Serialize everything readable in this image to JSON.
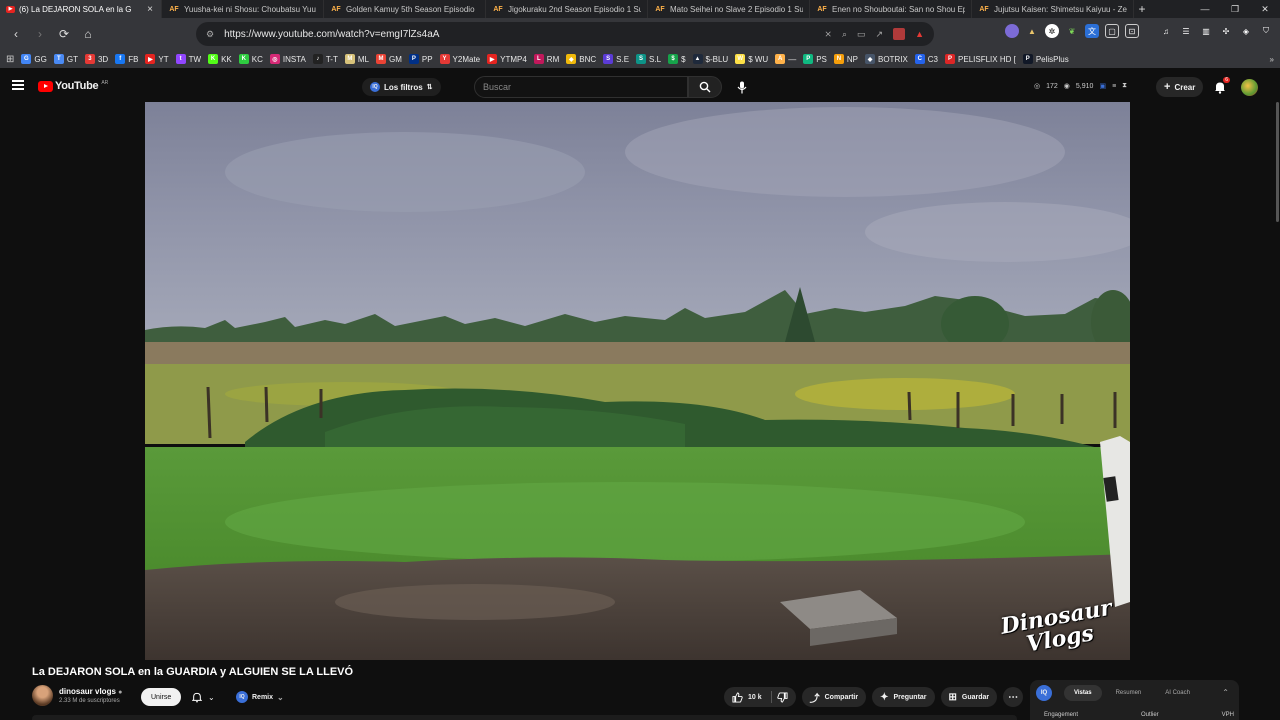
{
  "browser": {
    "tabs": [
      {
        "label": "(6) La DEJARON SOLA en la G",
        "icon": "youtube-icon",
        "active": true
      },
      {
        "label": "Yuusha-kei ni Shosu: Choubatsu Yuu",
        "icon": "af-icon"
      },
      {
        "label": "Golden Kamuy 5th Season Episodio",
        "icon": "af-icon"
      },
      {
        "label": "Jigokuraku 2nd Season Episodio 1 Su",
        "icon": "af-icon"
      },
      {
        "label": "Mato Seihei no Slave 2 Episodio 1 Su",
        "icon": "af-icon"
      },
      {
        "label": "Enen no Shouboutai: San no Shou Ep",
        "icon": "af-icon"
      },
      {
        "label": "Jujutsu Kaisen: Shimetsu Kaiyuu - Ze",
        "icon": "af-icon"
      }
    ],
    "af_label": "AF",
    "url": "https://www.youtube.com/watch?v=emgI7lZs4aA",
    "bookmarks": [
      {
        "label": "GG",
        "color": "#4285f4",
        "glyph": "G"
      },
      {
        "label": "GT",
        "color": "#4a8af4",
        "glyph": "T"
      },
      {
        "label": "3D",
        "color": "#e53935",
        "glyph": "3"
      },
      {
        "label": "FB",
        "color": "#1877f2",
        "glyph": "f"
      },
      {
        "label": "YT",
        "color": "#e52420",
        "glyph": "▶"
      },
      {
        "label": "TW",
        "color": "#9146ff",
        "glyph": "t"
      },
      {
        "label": "KK",
        "color": "#53fc18",
        "glyph": "K"
      },
      {
        "label": "KC",
        "color": "#2ecc40",
        "glyph": "K"
      },
      {
        "label": "INSTA",
        "color": "#d62976",
        "glyph": "◎"
      },
      {
        "label": "T-T",
        "color": "#222222",
        "glyph": "♪"
      },
      {
        "label": "ML",
        "color": "#d7c27a",
        "glyph": "M"
      },
      {
        "label": "GM",
        "color": "#ea4335",
        "glyph": "M"
      },
      {
        "label": "PP",
        "color": "#003087",
        "glyph": "P"
      },
      {
        "label": "Y2Mate",
        "color": "#e53935",
        "glyph": "Y"
      },
      {
        "label": "YTMP4",
        "color": "#e52420",
        "glyph": "▶"
      },
      {
        "label": "RM",
        "color": "#c2185b",
        "glyph": "L"
      },
      {
        "label": "BNC",
        "color": "#f0b90b",
        "glyph": "◆"
      },
      {
        "label": "S.E",
        "color": "#5b3bd6",
        "glyph": "S"
      },
      {
        "label": "S.L",
        "color": "#0d9488",
        "glyph": "S"
      },
      {
        "label": "$",
        "color": "#16a34a",
        "glyph": "$"
      },
      {
        "label": "$-BLU",
        "color": "#1e293b",
        "glyph": "▲"
      },
      {
        "label": "$ WU",
        "color": "#fde047",
        "glyph": "W"
      },
      {
        "label": "—",
        "color": "#ffb24a",
        "glyph": "A"
      },
      {
        "label": "PS",
        "color": "#10b981",
        "glyph": "P"
      },
      {
        "label": "NP",
        "color": "#f59e0b",
        "glyph": "N"
      },
      {
        "label": "BOTRIX",
        "color": "#475569",
        "glyph": "◆"
      },
      {
        "label": "C3",
        "color": "#2563eb",
        "glyph": "C"
      },
      {
        "label": "PELISFLIX HD [",
        "color": "#dc2626",
        "glyph": "P"
      },
      {
        "label": "PelisPlus",
        "color": "#111827",
        "glyph": "P"
      }
    ]
  },
  "youtube": {
    "logo_text": "YouTube",
    "country_code": "AR",
    "filters_label": "Los filtros",
    "filters_badge": "IQ",
    "search_placeholder": "Buscar",
    "stats": {
      "a": "172",
      "b": "5,910"
    },
    "create_label": "Crear",
    "notification_count": "6"
  },
  "video": {
    "title": "La DEJARON SOLA en la GUARDIA y ALGUIEN SE LA LLEVÓ",
    "watermark_line1": "Dinosaur",
    "watermark_line2": "Vlogs",
    "channel_name": "dinosaur vlogs",
    "subscribers": "2.33 M de suscriptores",
    "join_label": "Unirse",
    "remix_label": "Remix",
    "remix_badge": "IQ",
    "likes": "10 k",
    "share_label": "Compartir",
    "ask_label": "Preguntar",
    "save_label": "Guardar"
  },
  "side_panel": {
    "badge": "IQ",
    "tabs": [
      "Vistas",
      "Resumen",
      "AI Coach"
    ],
    "active_tab": "Vistas",
    "labels": [
      "Engagement",
      "Outlier",
      "VPH"
    ]
  }
}
